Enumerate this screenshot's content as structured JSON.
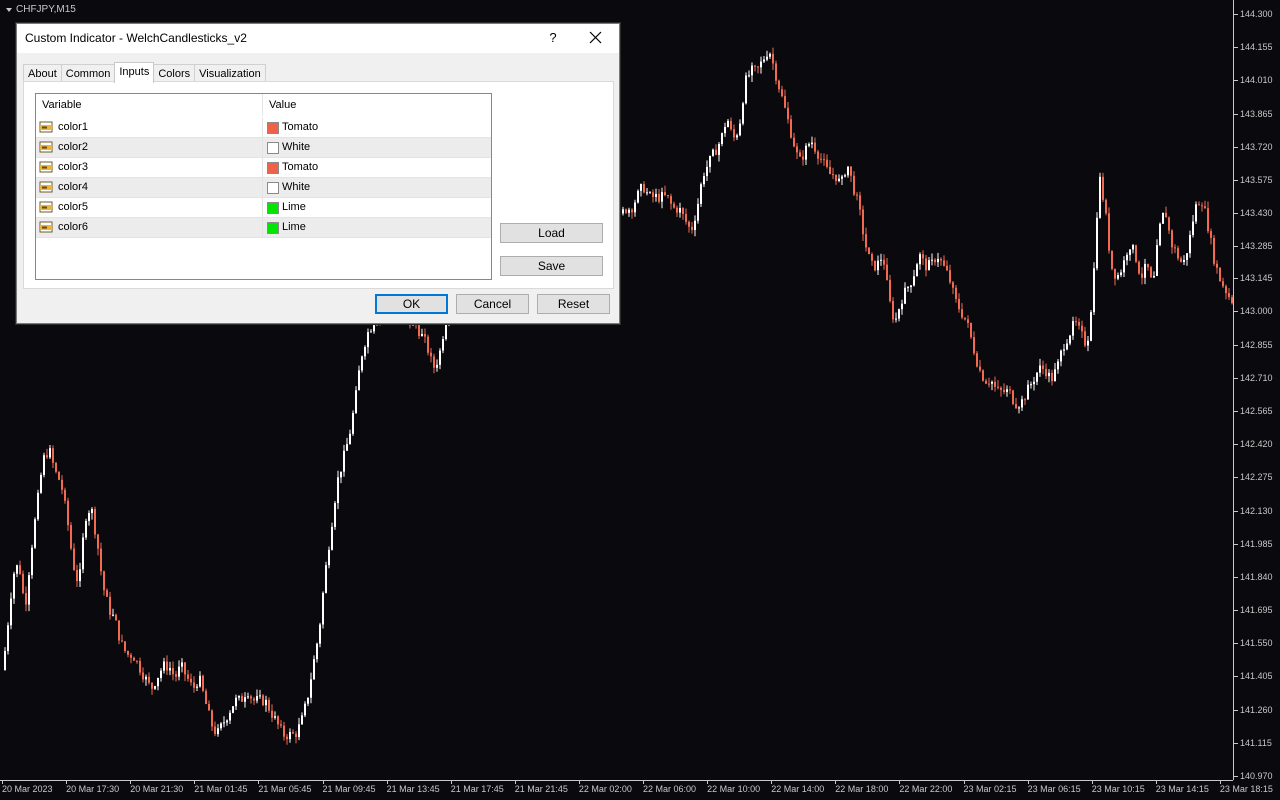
{
  "chart": {
    "symbol": "CHFJPY,M15",
    "bull_color": "#ffffff",
    "bear_color": "#f26b50",
    "background": "#0a0a0e",
    "price_ticks": [
      "144.300",
      "144.155",
      "144.010",
      "143.865",
      "143.720",
      "143.575",
      "143.430",
      "143.285",
      "143.145",
      "143.000",
      "142.855",
      "142.710",
      "142.565",
      "142.420",
      "142.275",
      "142.130",
      "141.985",
      "141.840",
      "141.695",
      "141.550",
      "141.405",
      "141.260",
      "141.115",
      "140.970"
    ],
    "time_ticks": [
      "20 Mar 2023",
      "20 Mar 17:30",
      "20 Mar 21:30",
      "21 Mar 01:45",
      "21 Mar 05:45",
      "21 Mar 09:45",
      "21 Mar 13:45",
      "21 Mar 17:45",
      "21 Mar 21:45",
      "22 Mar 02:00",
      "22 Mar 06:00",
      "22 Mar 10:00",
      "22 Mar 14:00",
      "22 Mar 18:00",
      "22 Mar 22:00",
      "23 Mar 02:15",
      "23 Mar 06:15",
      "23 Mar 10:15",
      "23 Mar 14:15",
      "23 Mar 18:15"
    ]
  },
  "chart_data": {
    "type": "candlestick",
    "title": "CHFJPY,M15",
    "ylim": [
      140.97,
      144.3
    ],
    "close_path": [
      [
        0,
        141.35
      ],
      [
        6,
        141.6
      ],
      [
        12,
        141.85
      ],
      [
        18,
        141.9
      ],
      [
        24,
        141.7
      ],
      [
        30,
        141.95
      ],
      [
        36,
        142.15
      ],
      [
        42,
        142.35
      ],
      [
        48,
        142.4
      ],
      [
        54,
        142.3
      ],
      [
        60,
        142.25
      ],
      [
        66,
        142.1
      ],
      [
        72,
        141.9
      ],
      [
        78,
        141.8
      ],
      [
        84,
        142.1
      ],
      [
        90,
        142.15
      ],
      [
        96,
        142.0
      ],
      [
        102,
        141.8
      ],
      [
        108,
        141.7
      ],
      [
        114,
        141.65
      ],
      [
        120,
        141.55
      ],
      [
        126,
        141.5
      ],
      [
        132,
        141.5
      ],
      [
        138,
        141.45
      ],
      [
        144,
        141.4
      ],
      [
        150,
        141.35
      ],
      [
        156,
        141.4
      ],
      [
        162,
        141.45
      ],
      [
        168,
        141.45
      ],
      [
        174,
        141.4
      ],
      [
        180,
        141.45
      ],
      [
        186,
        141.4
      ],
      [
        192,
        141.35
      ],
      [
        198,
        141.4
      ],
      [
        204,
        141.3
      ],
      [
        210,
        141.2
      ],
      [
        216,
        141.15
      ],
      [
        222,
        141.2
      ],
      [
        228,
        141.25
      ],
      [
        234,
        141.3
      ],
      [
        240,
        141.3
      ],
      [
        246,
        141.35
      ],
      [
        252,
        141.3
      ],
      [
        258,
        141.3
      ],
      [
        264,
        141.3
      ],
      [
        270,
        141.25
      ],
      [
        276,
        141.2
      ],
      [
        282,
        141.15
      ],
      [
        288,
        141.15
      ],
      [
        294,
        141.15
      ],
      [
        300,
        141.2
      ],
      [
        306,
        141.3
      ],
      [
        312,
        141.45
      ],
      [
        318,
        141.6
      ],
      [
        324,
        141.85
      ],
      [
        330,
        142.05
      ],
      [
        336,
        142.25
      ],
      [
        342,
        142.35
      ],
      [
        348,
        142.45
      ],
      [
        354,
        142.6
      ],
      [
        360,
        142.8
      ],
      [
        366,
        142.9
      ],
      [
        372,
        142.95
      ],
      [
        378,
        143.0
      ],
      [
        384,
        143.05
      ],
      [
        390,
        143.1
      ],
      [
        396,
        143.05
      ],
      [
        402,
        143.0
      ],
      [
        408,
        142.95
      ],
      [
        414,
        142.95
      ],
      [
        420,
        142.9
      ],
      [
        426,
        142.85
      ],
      [
        432,
        142.75
      ],
      [
        438,
        142.8
      ],
      [
        444,
        142.95
      ],
      [
        450,
        143.1
      ],
      [
        456,
        143.25
      ],
      [
        462,
        143.4
      ],
      [
        468,
        143.45
      ],
      [
        474,
        143.5
      ],
      [
        480,
        143.55
      ],
      [
        486,
        143.5
      ],
      [
        492,
        143.45
      ],
      [
        498,
        143.5
      ],
      [
        504,
        143.55
      ],
      [
        510,
        143.5
      ],
      [
        516,
        143.45
      ],
      [
        522,
        143.45
      ],
      [
        528,
        143.5
      ],
      [
        534,
        143.5
      ],
      [
        540,
        143.55
      ],
      [
        546,
        143.5
      ],
      [
        552,
        143.5
      ],
      [
        558,
        143.45
      ],
      [
        564,
        143.5
      ],
      [
        570,
        143.5
      ],
      [
        576,
        143.45
      ],
      [
        582,
        143.4
      ],
      [
        588,
        143.45
      ],
      [
        594,
        143.45
      ],
      [
        600,
        143.45
      ],
      [
        606,
        143.4
      ],
      [
        612,
        143.35
      ],
      [
        618,
        143.4
      ],
      [
        624,
        143.45
      ],
      [
        630,
        143.45
      ],
      [
        636,
        143.5
      ],
      [
        642,
        143.55
      ],
      [
        648,
        143.5
      ],
      [
        654,
        143.5
      ],
      [
        660,
        143.5
      ],
      [
        666,
        143.5
      ],
      [
        672,
        143.45
      ],
      [
        678,
        143.45
      ],
      [
        684,
        143.4
      ],
      [
        690,
        143.35
      ],
      [
        696,
        143.45
      ],
      [
        702,
        143.6
      ],
      [
        708,
        143.65
      ],
      [
        714,
        143.7
      ],
      [
        720,
        143.75
      ],
      [
        726,
        143.85
      ],
      [
        732,
        143.75
      ],
      [
        738,
        143.8
      ],
      [
        744,
        144.0
      ],
      [
        750,
        144.05
      ],
      [
        756,
        144.05
      ],
      [
        762,
        144.1
      ],
      [
        768,
        144.15
      ],
      [
        774,
        144.05
      ],
      [
        780,
        143.95
      ],
      [
        786,
        143.85
      ],
      [
        792,
        143.75
      ],
      [
        798,
        143.65
      ],
      [
        804,
        143.7
      ],
      [
        810,
        143.75
      ],
      [
        816,
        143.7
      ],
      [
        822,
        143.65
      ],
      [
        828,
        143.6
      ],
      [
        834,
        143.6
      ],
      [
        840,
        143.55
      ],
      [
        846,
        143.65
      ],
      [
        852,
        143.55
      ],
      [
        858,
        143.45
      ],
      [
        864,
        143.3
      ],
      [
        870,
        143.2
      ],
      [
        876,
        143.2
      ],
      [
        882,
        143.25
      ],
      [
        888,
        143.05
      ],
      [
        894,
        142.95
      ],
      [
        900,
        143.05
      ],
      [
        906,
        143.1
      ],
      [
        912,
        143.15
      ],
      [
        918,
        143.25
      ],
      [
        924,
        143.2
      ],
      [
        930,
        143.2
      ],
      [
        936,
        143.25
      ],
      [
        942,
        143.2
      ],
      [
        948,
        143.15
      ],
      [
        954,
        143.05
      ],
      [
        960,
        143.0
      ],
      [
        966,
        142.95
      ],
      [
        972,
        142.85
      ],
      [
        978,
        142.75
      ],
      [
        984,
        142.7
      ],
      [
        990,
        142.7
      ],
      [
        996,
        142.65
      ],
      [
        1002,
        142.65
      ],
      [
        1008,
        142.65
      ],
      [
        1014,
        142.6
      ],
      [
        1020,
        142.6
      ],
      [
        1026,
        142.65
      ],
      [
        1032,
        142.7
      ],
      [
        1038,
        142.75
      ],
      [
        1044,
        142.75
      ],
      [
        1050,
        142.7
      ],
      [
        1056,
        142.75
      ],
      [
        1062,
        142.85
      ],
      [
        1068,
        142.9
      ],
      [
        1074,
        142.95
      ],
      [
        1080,
        142.9
      ],
      [
        1086,
        142.85
      ],
      [
        1092,
        143.1
      ],
      [
        1098,
        143.6
      ],
      [
        1104,
        143.45
      ],
      [
        1110,
        143.2
      ],
      [
        1116,
        143.15
      ],
      [
        1122,
        143.2
      ],
      [
        1128,
        143.3
      ],
      [
        1134,
        143.25
      ],
      [
        1140,
        143.15
      ],
      [
        1146,
        143.2
      ],
      [
        1152,
        143.1
      ],
      [
        1158,
        143.35
      ],
      [
        1164,
        143.45
      ],
      [
        1170,
        143.3
      ],
      [
        1176,
        143.25
      ],
      [
        1182,
        143.2
      ],
      [
        1188,
        143.3
      ],
      [
        1194,
        143.45
      ],
      [
        1200,
        143.5
      ],
      [
        1206,
        143.4
      ],
      [
        1212,
        143.25
      ],
      [
        1218,
        143.15
      ],
      [
        1224,
        143.1
      ],
      [
        1230,
        143.05
      ]
    ]
  },
  "dialog": {
    "title": "Custom Indicator - WelchCandlesticks_v2",
    "help": "?",
    "tabs": [
      "About",
      "Common",
      "Inputs",
      "Colors",
      "Visualization"
    ],
    "active_tab": "Inputs",
    "grid": {
      "col_variable": "Variable",
      "col_value": "Value",
      "rows": [
        {
          "variable": "color1",
          "value": "Tomato",
          "color": "#f0614a"
        },
        {
          "variable": "color2",
          "value": "White",
          "color": "#ffffff"
        },
        {
          "variable": "color3",
          "value": "Tomato",
          "color": "#f0614a"
        },
        {
          "variable": "color4",
          "value": "White",
          "color": "#ffffff"
        },
        {
          "variable": "color5",
          "value": "Lime",
          "color": "#00e600"
        },
        {
          "variable": "color6",
          "value": "Lime",
          "color": "#00e600"
        }
      ]
    },
    "load_label": "Load",
    "save_label": "Save",
    "ok_label": "OK",
    "cancel_label": "Cancel",
    "reset_label": "Reset"
  }
}
